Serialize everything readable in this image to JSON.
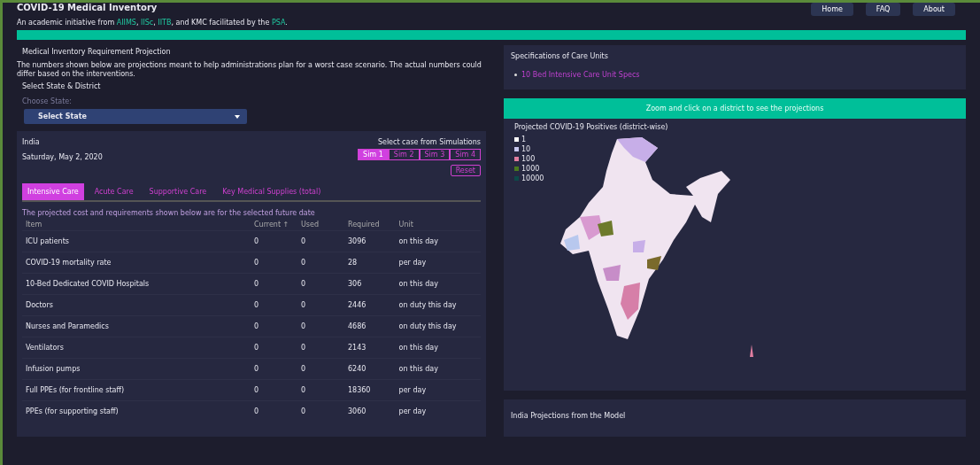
{
  "header": {
    "title": "COVID-19 Medical Inventory",
    "subtitle_parts": [
      {
        "text": "An academic initiative from ",
        "link": false
      },
      {
        "text": "AIIMS",
        "link": true
      },
      {
        "text": ", ",
        "link": false
      },
      {
        "text": "IISc",
        "link": true
      },
      {
        "text": ", ",
        "link": false
      },
      {
        "text": "IITB",
        "link": true
      },
      {
        "text": ", and KMC facilitated by the ",
        "link": false
      },
      {
        "text": "PSA",
        "link": true
      }
    ],
    "subtitle_end": ".",
    "nav": [
      "Home",
      "FAQ",
      "About"
    ]
  },
  "projection": {
    "title": "Medical Inventory Requirement Projection",
    "description": "The numbers shown below are projections meant to help administrations plan for a worst case scenario. The actual numbers could differ based on the interventions.",
    "select_label": "Select State & District",
    "state_label": "Choose State:",
    "state_value": "Select State"
  },
  "summary": {
    "region": "India",
    "date": "Saturday, May 2, 2020",
    "sim_label": "Select case from Simulations",
    "sims": [
      {
        "label": "Sim 1",
        "selected": true
      },
      {
        "label": "Sim 2",
        "selected": false
      },
      {
        "label": "Sim 3",
        "selected": false
      },
      {
        "label": "Sim 4",
        "selected": false
      }
    ],
    "reset": "Reset"
  },
  "tabs": [
    {
      "label": "Intensive Care",
      "selected": true
    },
    {
      "label": "Acute Care",
      "selected": false
    },
    {
      "label": "Supportive Care",
      "selected": false
    },
    {
      "label": "Key Medical Supplies (total)",
      "selected": false
    }
  ],
  "table": {
    "note": "The projected cost and requirements shown below are for the selected future date",
    "columns": [
      "Item",
      "Current ↑",
      "Used",
      "Required",
      "Unit"
    ],
    "rows": [
      [
        "ICU patients",
        "0",
        "0",
        "3096",
        "on this day"
      ],
      [
        "COVID-19 mortality rate",
        "0",
        "0",
        "28",
        "per day"
      ],
      [
        "10-Bed Dedicated COVID Hospitals",
        "0",
        "0",
        "306",
        "on this day"
      ],
      [
        "Doctors",
        "0",
        "0",
        "2446",
        "on duty this day"
      ],
      [
        "Nurses and Paramedics",
        "0",
        "0",
        "4686",
        "on duty this day"
      ],
      [
        "Ventilators",
        "0",
        "0",
        "2143",
        "on this day"
      ],
      [
        "Infusion pumps",
        "0",
        "0",
        "6240",
        "on this day"
      ],
      [
        "Full PPEs (for frontline staff)",
        "0",
        "0",
        "18360",
        "per day"
      ],
      [
        "PPEs (for supporting staff)",
        "0",
        "0",
        "3060",
        "per day"
      ]
    ]
  },
  "specs": {
    "title": "Specifications of Care Units",
    "links": [
      "10 Bed Intensive Care Unit Specs"
    ]
  },
  "map": {
    "banner": "Zoom and click on a district to see the projections",
    "title": "Projected COVID-19 Positives (district-wise)",
    "legend": [
      {
        "label": "1",
        "color": "#ffffff"
      },
      {
        "label": "10",
        "color": "#c8c8f0"
      },
      {
        "label": "100",
        "color": "#e07ea0"
      },
      {
        "label": "1000",
        "color": "#4a7a1e"
      },
      {
        "label": "10000",
        "color": "#0d4a4a"
      }
    ]
  },
  "model": {
    "title": "India Projections from the Model"
  }
}
